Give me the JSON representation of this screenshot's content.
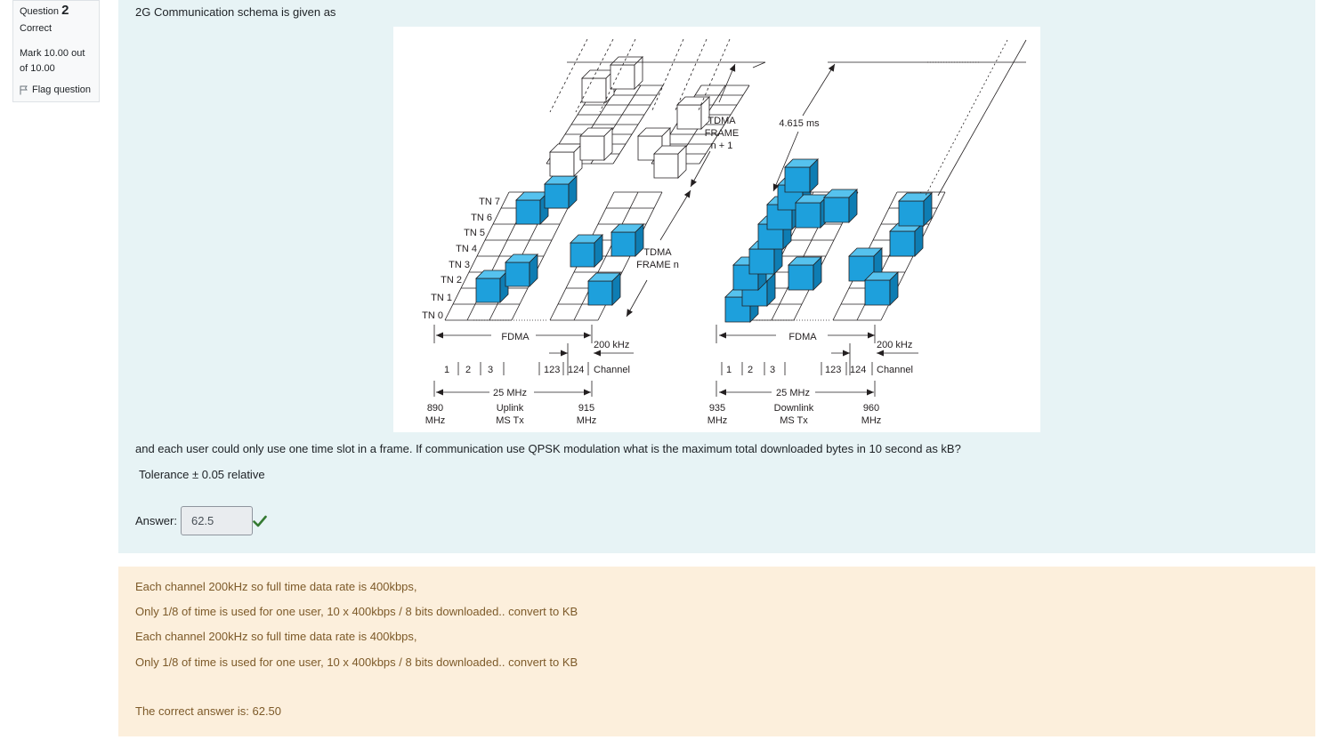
{
  "question": {
    "number_prefix": "Question",
    "number": "2",
    "state": "Correct",
    "grade": "Mark 10.00 out of 10.00",
    "flag_label": "Flag question"
  },
  "content": {
    "intro": "2G Communication schema is given as",
    "body": "and each user could only use one time slot in a frame. If communication use QPSK modulation what is the maximum total downloaded bytes in 10 second as kB?",
    "tolerance": "Tolerance ± 0.05 relative",
    "answer_label": "Answer:",
    "answer_value": "62.5",
    "answer_status": "correct"
  },
  "figure": {
    "timeslots": [
      "TN 7",
      "TN 6",
      "TN 5",
      "TN 4",
      "TN 3",
      "TN 2",
      "TN 1",
      "TN 0"
    ],
    "tdma_frame_next": [
      "TDMA",
      "FRAME",
      "n + 1"
    ],
    "tdma_frame": [
      "TDMA",
      "FRAME n"
    ],
    "frame_duration": "4.615 ms",
    "fdma": "FDMA",
    "channel_width": "200 kHz",
    "channels_low": [
      "1",
      "2",
      "3"
    ],
    "channels_high": [
      "123",
      "124"
    ],
    "channel_label": "Channel",
    "band_width": "25 MHz",
    "uplink": {
      "start": [
        "890",
        "MHz"
      ],
      "name": [
        "Uplink",
        "MS Tx"
      ],
      "end": [
        "915",
        "MHz"
      ]
    },
    "downlink": {
      "start": [
        "935",
        "MHz"
      ],
      "name": [
        "Downlink",
        "MS Tx"
      ],
      "end": [
        "960",
        "MHz"
      ]
    },
    "colors": {
      "slot_fill": "#1ea0dc",
      "slot_top": "#56c2ee",
      "slot_side": "#0e7db3",
      "empty_slot": "#ffffff"
    }
  },
  "feedback": {
    "lines": [
      "Each channel 200kHz so full time data rate is 400kbps,",
      "Only 1/8 of time is used for one user, 10 x 400kbps / 8  bits downloaded.. convert to KB",
      "Each channel 200kHz so full time data rate is 400kbps,",
      "Only 1/8 of time is used for one user, 10 x 400kbps / 8  bits downloaded.. convert to KB"
    ],
    "right_answer": "The correct answer is: 62.50"
  }
}
